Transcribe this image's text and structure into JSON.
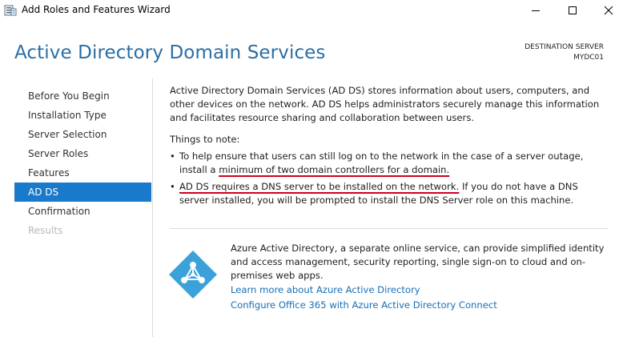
{
  "window": {
    "title": "Add Roles and Features Wizard",
    "controls": [
      "minimize-icon",
      "maximize-icon",
      "close-icon"
    ]
  },
  "header": {
    "page_title": "Active Directory Domain Services",
    "destination_label": "DESTINATION SERVER",
    "destination_server": "MYDC01"
  },
  "nav": {
    "items": [
      {
        "label": "Before You Begin",
        "state": "normal"
      },
      {
        "label": "Installation Type",
        "state": "normal"
      },
      {
        "label": "Server Selection",
        "state": "normal"
      },
      {
        "label": "Server Roles",
        "state": "normal"
      },
      {
        "label": "Features",
        "state": "normal"
      },
      {
        "label": "AD DS",
        "state": "active"
      },
      {
        "label": "Confirmation",
        "state": "normal"
      },
      {
        "label": "Results",
        "state": "disabled"
      }
    ]
  },
  "content": {
    "intro": "Active Directory Domain Services (AD DS) stores information about users, computers, and other devices on the network.  AD DS helps administrators securely manage this information and facilitates resource sharing and collaboration between users.",
    "things_to_note": "Things to note:",
    "bullet1_pre": "To help ensure that users can still log on to the network in the case of a server outage, install a ",
    "bullet1_emph": "minimum of two domain controllers for a domain.",
    "bullet2_emph": "AD DS requires a DNS server to be installed on the network.",
    "bullet2_post": "  If you do not have a DNS server installed, you will be prompted to install the DNS Server role on this machine.",
    "azure_text": "Azure Active Directory, a separate online service, can provide simplified identity and access management, security reporting, single sign-on to cloud and on-premises web apps.",
    "link1": "Learn more about Azure Active Directory",
    "link2": "Configure Office 365 with Azure Active Directory Connect"
  },
  "colors": {
    "title_blue": "#2b6ea3",
    "nav_active": "#1979ca",
    "link_blue": "#1a6fb5",
    "underline_red": "#d1001f",
    "azure_icon": "#3aa2d9"
  }
}
